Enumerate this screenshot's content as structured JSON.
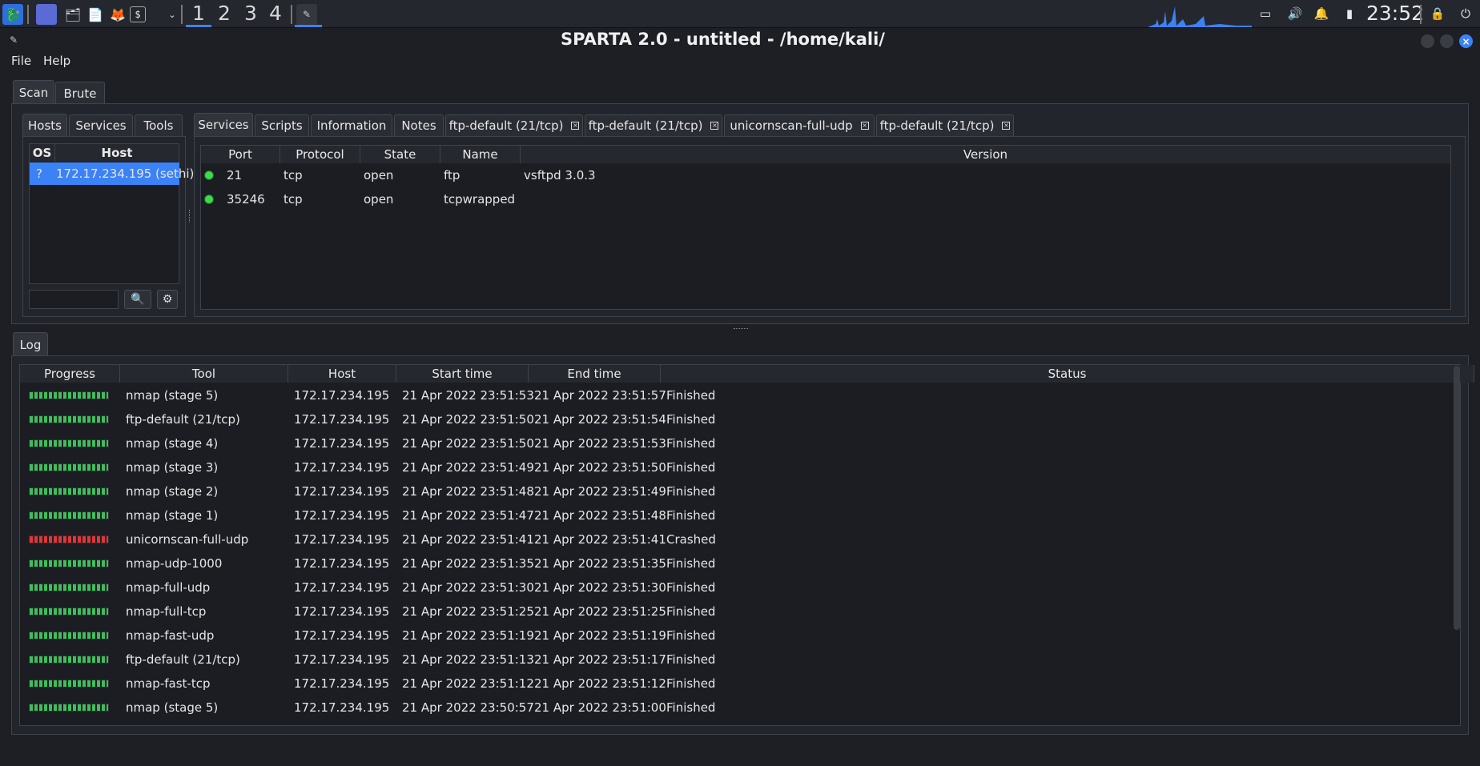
{
  "taskbar": {
    "workspaces": [
      "1",
      "2",
      "3",
      "4"
    ],
    "clock": "23:52"
  },
  "window": {
    "title": "SPARTA 2.0 - untitled - /home/kali/",
    "close_glyph": "×"
  },
  "menu": {
    "file": "File",
    "help": "Help"
  },
  "top_tabs": {
    "scan": "Scan",
    "brute": "Brute"
  },
  "left_tabs": {
    "hosts": "Hosts",
    "services": "Services",
    "tools": "Tools"
  },
  "hosts_table": {
    "headers": {
      "os": "OS",
      "host": "Host"
    },
    "rows": [
      {
        "os": "?",
        "host": "172.17.234.195 (sethi)"
      }
    ]
  },
  "right_tabs": [
    "Services",
    "Scripts",
    "Information",
    "Notes",
    "ftp-default (21/tcp)",
    "ftp-default (21/tcp)",
    "unicornscan-full-udp",
    "ftp-default (21/tcp)"
  ],
  "services_table": {
    "headers": [
      "Port",
      "Protocol",
      "State",
      "Name",
      "Version"
    ],
    "rows": [
      {
        "port": "21",
        "protocol": "tcp",
        "state": "open",
        "name": "ftp",
        "version": "vsftpd 3.0.3"
      },
      {
        "port": "35246",
        "protocol": "tcp",
        "state": "open",
        "name": "tcpwrapped",
        "version": ""
      }
    ]
  },
  "log": {
    "tab": "Log",
    "headers": [
      "Progress",
      "Tool",
      "Host",
      "Start time",
      "End time",
      "Status"
    ],
    "rows": [
      {
        "tool": "nmap (stage 5)",
        "host": "172.17.234.195",
        "start": "21 Apr 2022 23:51:53",
        "end": "21 Apr 2022 23:51:57",
        "status": "Finished"
      },
      {
        "tool": "ftp-default (21/tcp)",
        "host": "172.17.234.195",
        "start": "21 Apr 2022 23:51:50",
        "end": "21 Apr 2022 23:51:54",
        "status": "Finished"
      },
      {
        "tool": "nmap (stage 4)",
        "host": "172.17.234.195",
        "start": "21 Apr 2022 23:51:50",
        "end": "21 Apr 2022 23:51:53",
        "status": "Finished"
      },
      {
        "tool": "nmap (stage 3)",
        "host": "172.17.234.195",
        "start": "21 Apr 2022 23:51:49",
        "end": "21 Apr 2022 23:51:50",
        "status": "Finished"
      },
      {
        "tool": "nmap (stage 2)",
        "host": "172.17.234.195",
        "start": "21 Apr 2022 23:51:48",
        "end": "21 Apr 2022 23:51:49",
        "status": "Finished"
      },
      {
        "tool": "nmap (stage 1)",
        "host": "172.17.234.195",
        "start": "21 Apr 2022 23:51:47",
        "end": "21 Apr 2022 23:51:48",
        "status": "Finished"
      },
      {
        "tool": "unicornscan-full-udp",
        "host": "172.17.234.195",
        "start": "21 Apr 2022 23:51:41",
        "end": "21 Apr 2022 23:51:41",
        "status": "Crashed"
      },
      {
        "tool": "nmap-udp-1000",
        "host": "172.17.234.195",
        "start": "21 Apr 2022 23:51:35",
        "end": "21 Apr 2022 23:51:35",
        "status": "Finished"
      },
      {
        "tool": "nmap-full-udp",
        "host": "172.17.234.195",
        "start": "21 Apr 2022 23:51:30",
        "end": "21 Apr 2022 23:51:30",
        "status": "Finished"
      },
      {
        "tool": "nmap-full-tcp",
        "host": "172.17.234.195",
        "start": "21 Apr 2022 23:51:25",
        "end": "21 Apr 2022 23:51:25",
        "status": "Finished"
      },
      {
        "tool": "nmap-fast-udp",
        "host": "172.17.234.195",
        "start": "21 Apr 2022 23:51:19",
        "end": "21 Apr 2022 23:51:19",
        "status": "Finished"
      },
      {
        "tool": "ftp-default (21/tcp)",
        "host": "172.17.234.195",
        "start": "21 Apr 2022 23:51:13",
        "end": "21 Apr 2022 23:51:17",
        "status": "Finished"
      },
      {
        "tool": "nmap-fast-tcp",
        "host": "172.17.234.195",
        "start": "21 Apr 2022 23:51:12",
        "end": "21 Apr 2022 23:51:12",
        "status": "Finished"
      },
      {
        "tool": "nmap (stage 5)",
        "host": "172.17.234.195",
        "start": "21 Apr 2022 23:50:57",
        "end": "21 Apr 2022 23:51:00",
        "status": "Finished"
      }
    ]
  },
  "colors": {
    "accent": "#3b82f6",
    "progress_ok": "#3fbf5a",
    "progress_crash": "#e23636",
    "background": "#1d1f24"
  }
}
